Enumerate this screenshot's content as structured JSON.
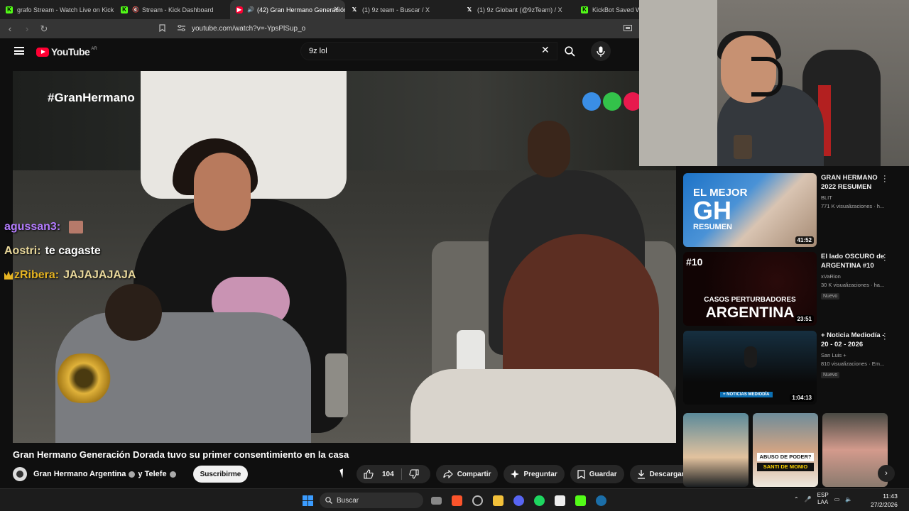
{
  "browser": {
    "tabs": [
      {
        "label": "grafo Stream - Watch Live on Kick",
        "favicon": "kick-icon"
      },
      {
        "label": "Stream - Kick Dashboard",
        "favicon": "kick-icon"
      },
      {
        "label": "(42) Gran Hermano Generación",
        "favicon": "youtube-icon",
        "active": true
      },
      {
        "label": "(1) 9z team - Buscar / X",
        "favicon": "x-icon"
      },
      {
        "label": "(1) 9z Globant (@9zTeam) / X",
        "favicon": "x-icon"
      },
      {
        "label": "KickBot Saved Wi",
        "favicon": "kick-icon"
      }
    ],
    "url": "youtube.com/watch?v=-YpsPlSup_o"
  },
  "youtube": {
    "logo_text": "YouTube",
    "country_code": "AR",
    "search_value": "9z lol"
  },
  "video": {
    "overlay_hashtag": "#GranHermano",
    "dot_colors": [
      "#3a8ee6",
      "#33c24a",
      "#e8194d"
    ],
    "chat": [
      {
        "user": "agussan3:",
        "message": "",
        "user_color": "#b47cff",
        "msg_color": "#ffffff"
      },
      {
        "user": "Aostri:",
        "message": "te cagaste",
        "user_color": "#e8d79a",
        "msg_color": "#ffffff"
      },
      {
        "user": "zRibera:",
        "message": "JAJAJAJAJA",
        "user_color": "#e6b422",
        "msg_color": "#e8d79a"
      }
    ],
    "title": "Gran Hermano Generación Dorada tuvo su primer consentimiento en la casa",
    "channel": "Gran Hermano Argentina",
    "channel_joiner": "y Telefe",
    "subscribe_label": "Suscribirme",
    "like_count": "104",
    "share_label": "Compartir",
    "ask_label": "Preguntar",
    "save_label": "Guardar",
    "download_label": "Descargar"
  },
  "recommendations": [
    {
      "title": "GRAN HERMANO 2022 RESUMEN",
      "channel": "BLIT",
      "meta": "771 K visualizaciones · h...",
      "duration": "41:52",
      "badge": "",
      "thumb_text_1": "EL MEJOR",
      "thumb_text_2": "GH",
      "thumb_text_3": "RESUMEN"
    },
    {
      "title": "El lado OSCURO de ARGENTINA #10",
      "channel": "xVaRion",
      "meta": "30 K visualizaciones · ha...",
      "duration": "23:51",
      "badge": "Nuevo",
      "thumb_text_1": "#10",
      "thumb_text_2": "CASOS PERTURBADORES",
      "thumb_text_3": "ARGENTINA"
    },
    {
      "title": "+ Noticia Mediodía - 20 - 02 - 2026",
      "channel": "San Luis +",
      "meta": "810 visualizaciones · Em...",
      "duration": "1:04:13",
      "badge": "Nuevo",
      "thumb_text_1": "+ NOTICIAS MEDIODÍA",
      "thumb_text_2": "",
      "thumb_text_3": ""
    }
  ],
  "shorts": {
    "badge_1": "ABUSO DE PODER?",
    "badge_2": "SANTI DE MONIO"
  },
  "taskbar": {
    "search_placeholder": "Buscar",
    "lang_1": "ESP",
    "lang_2": "LAA",
    "time": "11:43",
    "date": "27/2/2026"
  }
}
